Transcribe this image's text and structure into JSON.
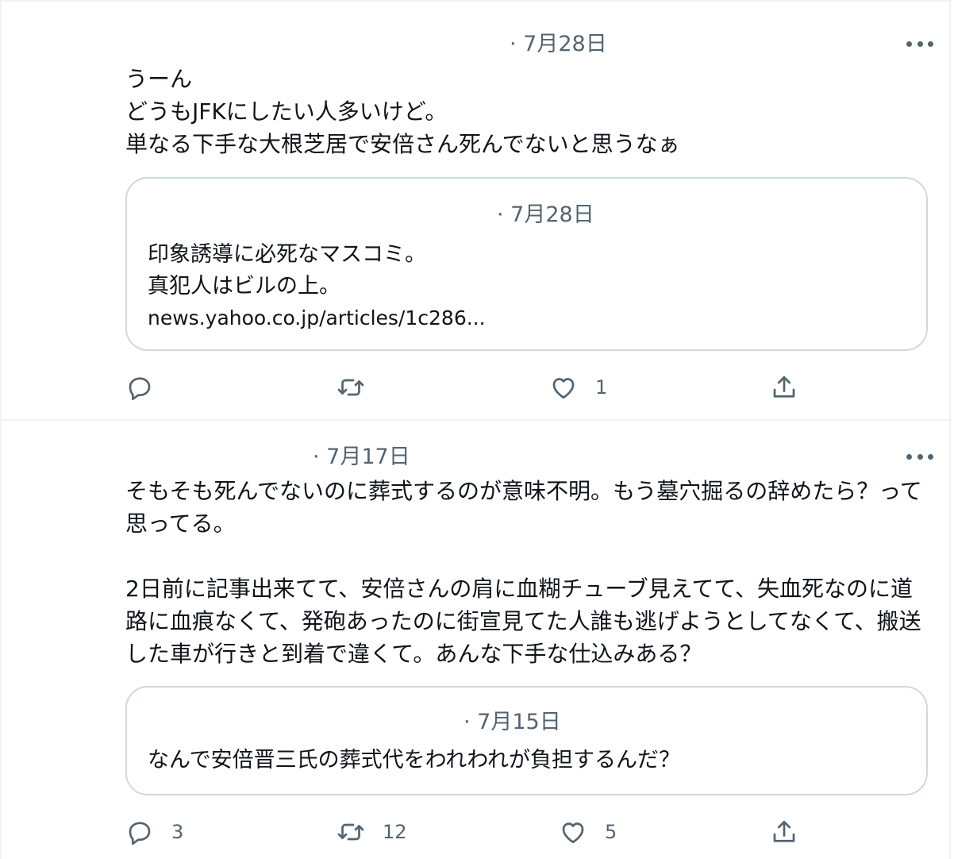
{
  "tweets": [
    {
      "date": "· 7月28日",
      "text": "うーん\nどうもJFKにしたい人多いけど。\n単なる下手な大根芝居で安倍さん死んでないと思うなぁ",
      "quote": {
        "date": "· 7月28日",
        "text": "印象誘導に必死なマスコミ。\n真犯人はビルの上。",
        "link": "news.yahoo.co.jp/articles/1c286..."
      },
      "actions": {
        "reply": "",
        "retweet": "",
        "like": "1",
        "share": ""
      }
    },
    {
      "date": "· 7月17日",
      "text": "そもそも死んでないのに葬式するのが意味不明。もう墓穴掘るの辞めたら？って思ってる。\n\n2日前に記事出来てて、安倍さんの肩に血糊チューブ見えてて、失血死なのに道路に血痕なくて、発砲あったのに街宣見てた人誰も逃げようとしてなくて、搬送した車が行きと到着で違くて。あんな下手な仕込みある？",
      "quote": {
        "date": "· 7月15日",
        "text": "なんで安倍晋三氏の葬式代をわれわれが負担するんだ？"
      },
      "actions": {
        "reply": "3",
        "retweet": "12",
        "like": "5",
        "share": ""
      }
    }
  ],
  "icons": {
    "reply": "reply-icon",
    "retweet": "retweet-icon",
    "like": "heart-icon",
    "share": "share-icon",
    "more": "more-icon"
  },
  "colors": {
    "text": "#0f1419",
    "secondary": "#536471",
    "border": "#cfd9de",
    "divider": "#eff3f4"
  }
}
